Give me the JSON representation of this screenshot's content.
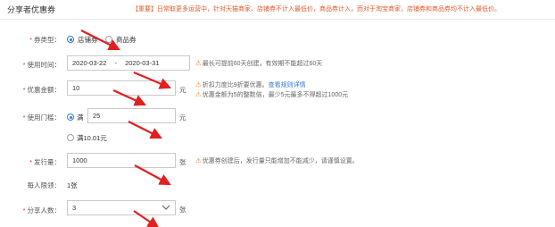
{
  "header": {
    "title": "分享者优惠券",
    "note": "【重要】日常取更多运营中，针对天猫商家、店铺券不计入最低价，商品券计入，而对于淘宝商家，店铺券和商品券均不计入最低价。"
  },
  "coupon_type": {
    "label": "券类型：",
    "options": [
      {
        "label": "店铺券",
        "selected": true
      },
      {
        "label": "商品券",
        "selected": false
      }
    ]
  },
  "use_time": {
    "label": "使用时间：",
    "start": "2020-03-22",
    "separator": "-",
    "end": "2020-03-31",
    "hint": "最长可提前60天创建，有效期不能超过60天"
  },
  "discount": {
    "label": "优惠金额：",
    "value": "10",
    "unit": "元",
    "hint1": "折扣力度比9折要优惠。",
    "hint1_link": "查看规则详情",
    "hint2": "优惠金额为5的整数倍，最少5元最多不得超过1000元"
  },
  "threshold": {
    "label": "使用门槛：",
    "option1_prefix": "满",
    "value": "25",
    "unit": "元",
    "option2": "满10.01元"
  },
  "issue_qty": {
    "label": "发行量：",
    "value": "1000",
    "unit": "张",
    "hint": "优惠券创建后，发行量只能增加不能减少，请谨慎设置。"
  },
  "per_limit": {
    "label": "每人限领：",
    "value": "1张"
  },
  "sharers": {
    "label": "分享人数：",
    "value": "3",
    "unit": "张"
  },
  "colors": {
    "accent": "#3a78d6",
    "required": "#e53935",
    "warning": "#e8812c",
    "annotation_arrow": "#e02020"
  }
}
